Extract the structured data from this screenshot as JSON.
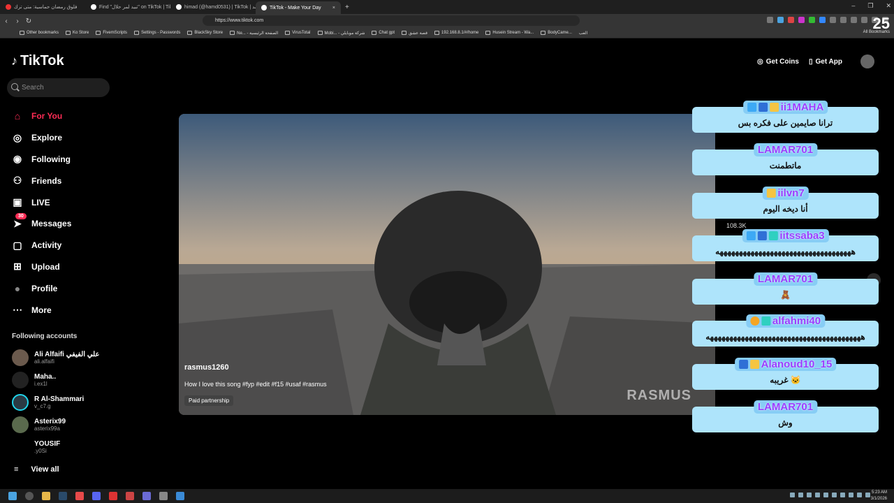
{
  "browser": {
    "tabs": [
      {
        "title": "فلوق رمضان حماسية: متى ترك"
      },
      {
        "title": "Find \"تبيد لمر حلال\" on TikTok | TikTok"
      },
      {
        "title": "himad (@hamd0531) | TikTok | حمد"
      },
      {
        "title": "TikTok - Make Your Day",
        "close": "×"
      }
    ],
    "new_tab": "+",
    "url": "https://www.tiktok.com",
    "bookmarks": [
      "Other bookmarks",
      "Ko Store",
      "FivemScripts",
      "Settings - Passwords",
      "BlackSky Store",
      "Ne... - الصفحة الرئيسية",
      "VirusTotal",
      "Mobi... - شركة موبايلي",
      "Chat gpt",
      "قصة عشق",
      "192.168.8.1/#/home",
      "Husein Stream - Wa...",
      "BodyCame...",
      "العب"
    ],
    "all_bookmarks": "All Bookmarks"
  },
  "overlay_number": "25",
  "tiktok": {
    "logo": "TikTok",
    "search_placeholder": "Search",
    "nav": [
      {
        "label": "For You",
        "icon": "home-icon",
        "glyph": "⌂"
      },
      {
        "label": "Explore",
        "icon": "compass-icon",
        "glyph": "◎"
      },
      {
        "label": "Following",
        "icon": "following-icon",
        "glyph": "◉"
      },
      {
        "label": "Friends",
        "icon": "friends-icon",
        "glyph": "⚇"
      },
      {
        "label": "LIVE",
        "icon": "live-icon",
        "glyph": "▣"
      },
      {
        "label": "Messages",
        "icon": "messages-icon",
        "glyph": "➤",
        "badge": "30"
      },
      {
        "label": "Activity",
        "icon": "activity-icon",
        "glyph": "▢"
      },
      {
        "label": "Upload",
        "icon": "upload-icon",
        "glyph": "⊞"
      },
      {
        "label": "Profile",
        "icon": "profile-icon",
        "glyph": "●"
      },
      {
        "label": "More",
        "icon": "more-icon",
        "glyph": "⋯"
      }
    ],
    "following_title": "Following accounts",
    "accounts": [
      {
        "name": "Ali Alfaifi علي الفيفي",
        "handle": "ali.alfaifi"
      },
      {
        "name": "Maha..",
        "handle": "i.ex1l"
      },
      {
        "name": "R Al-Shammari",
        "handle": "v_c7.g"
      },
      {
        "name": "Asterix99",
        "handle": "asterix99a"
      },
      {
        "name": "YOUSIF",
        "handle": ".y0Si"
      }
    ],
    "view_all": "View all",
    "get_coins": "Get Coins",
    "get_app": "Get App",
    "video": {
      "username": "rasmus1260",
      "description": "How I love this song  #fyp #edit #f15 #usaf #rasmus",
      "paid": "Paid partnership",
      "watermark": "RASMUS"
    },
    "side_count": "108.3K"
  },
  "chat": [
    {
      "name": "ii1MAHA",
      "message": "ترانا صايمين على فكره بس",
      "badges": [
        "#3da9f5",
        "#2f6fd6",
        "#f5c542"
      ]
    },
    {
      "name": "LAMAR701",
      "message": "ماتطمنت",
      "badges": []
    },
    {
      "name": "iilvn7",
      "message": "أنا ديخه اليوم",
      "badges": [
        "#f5c542"
      ]
    },
    {
      "name": "iitssaba3",
      "message": "هههههههههههههههههههههههههههههههههههه",
      "badges": [
        "#3da9f5",
        "#2f6fd6",
        "#2fd0c0"
      ]
    },
    {
      "name": "LAMAR701",
      "message": "🧸",
      "badges": []
    },
    {
      "name": "alfahmi40",
      "message": "ههههههههههههههههههههههههههههههههههههههههه",
      "badges": [
        "#f5a623",
        "#2fd0c0"
      ]
    },
    {
      "name": "Alanoud10_15",
      "message": "غريبه 🐱",
      "badges": [
        "#2f6fd6",
        "#f5c542"
      ]
    },
    {
      "name": "LAMAR701",
      "message": "وش",
      "badges": []
    }
  ],
  "taskbar": {
    "time": "5:23 AM",
    "date": "3/1/2026"
  }
}
